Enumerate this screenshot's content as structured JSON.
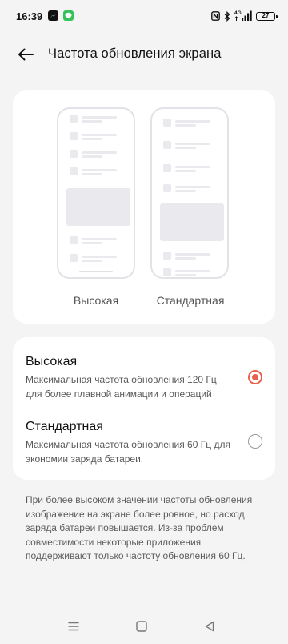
{
  "status_bar": {
    "time": "16:39",
    "notification_icons": [
      "messenger-icon",
      "wechat-icon"
    ],
    "right_icons": [
      "nfc-icon",
      "bluetooth-icon",
      "lte-signal-icon",
      "battery-icon"
    ],
    "network": "4G",
    "battery_level": "27"
  },
  "header": {
    "back_icon": "arrow-left-icon",
    "title": "Частота обновления экрана"
  },
  "preview": {
    "high_label": "Высокая",
    "standard_label": "Стандартная"
  },
  "options": [
    {
      "title": "Высокая",
      "description": "Максимальная частота обновления 120 Гц для более плавной анимации и операций",
      "selected": true
    },
    {
      "title": "Стандартная",
      "description": "Максимальная частота обновления 60 Гц для экономии заряда батареи.",
      "selected": false
    }
  ],
  "footnote": "При более высоком значении частоты обновления изображение на экране более ровное, но расход заряда батареи повышается. Из-за проблем совместимости некоторые приложения поддерживают только частоту обновления 60 Гц.",
  "nav_bar": {
    "icons": [
      "menu-icon",
      "home-icon",
      "back-icon"
    ]
  },
  "colors": {
    "accent": "#e8604c",
    "background": "#f4f4f5",
    "card": "#ffffff",
    "placeholder": "#e9e9ee"
  }
}
